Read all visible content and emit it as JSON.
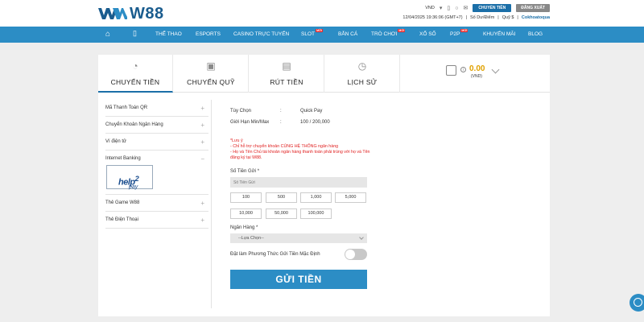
{
  "brand": {
    "name": "W88",
    "accent": "#2c8dc5",
    "logo_color": "#1a5c8e"
  },
  "header": {
    "currency": "VND",
    "deposit_label": "CHUYỂN TIỀN",
    "logout_label": "ĐĂNG XUẤT",
    "datetime": "12/04/2025 19:36:06 (GMT+7)",
    "points_label": "Số Dư/Điểm",
    "fund_label": "Quỹ $",
    "username": "Cokhoatoqua"
  },
  "nav": {
    "items": [
      "THỂ THAO",
      "ESPORTS",
      "CASINO TRỰC TUYẾN",
      "SLOT",
      "BẮN CÁ",
      "TRÒ CHƠI",
      "XỔ SỐ",
      "P2P",
      "KHUYẾN MÃI",
      "BLOG"
    ],
    "new_badge": "MỚI"
  },
  "tabs": [
    {
      "label": "CHUYỂN TIỀN",
      "icon": "piggy-bank-icon",
      "active": true
    },
    {
      "label": "CHUYỂN QUỸ",
      "icon": "transfer-icon",
      "active": false
    },
    {
      "label": "RÚT TIỀN",
      "icon": "withdraw-icon",
      "active": false
    },
    {
      "label": "LỊCH SỬ",
      "icon": "history-icon",
      "active": false
    }
  ],
  "balance": {
    "amount": "0.00",
    "unit": "(VND)",
    "color": "#e0a100"
  },
  "sidebar": {
    "items": [
      {
        "label": "Mã Thanh Toán QR"
      },
      {
        "label": "Chuyển Khoản Ngân Hàng"
      },
      {
        "label": "Ví điện tử"
      },
      {
        "label": "Internet Banking",
        "open": true
      },
      {
        "label": "Thẻ Game W88"
      },
      {
        "label": "Thẻ Điện Thoại"
      }
    ],
    "help2pay": {
      "top": "help",
      "num": "2",
      "bottom": "pay"
    }
  },
  "form": {
    "option_label": "Tùy Chọn",
    "option_value": "Quick Pay",
    "limit_label": "Giới Hạn Min/Max",
    "limit_value": "100 / 200,000",
    "separator": ":",
    "note_title": "*Lưu ý",
    "note_line1": "- Chỉ hỗ trợ chuyển khoản CÙNG HỆ THỐNG ngân hàng",
    "note_line2": "- Họ và Tên Chủ tài khoản ngân hàng thanh toán phải trùng với họ và Tên đăng ký tại W88.",
    "amount_label": "Số Tiền Gửi *",
    "amount_placeholder": "Số Tiền Gửi",
    "quick_amounts": [
      "100",
      "500",
      "1,000",
      "5,000",
      "10,000",
      "50,000",
      "100,000"
    ],
    "bank_label": "Ngân Hàng *",
    "bank_placeholder": "--Lựa Chọn--",
    "default_label": "Đặt làm Phương Thức Gửi Tiền Mặc Định",
    "submit_label": "GỬI TIỀN"
  }
}
